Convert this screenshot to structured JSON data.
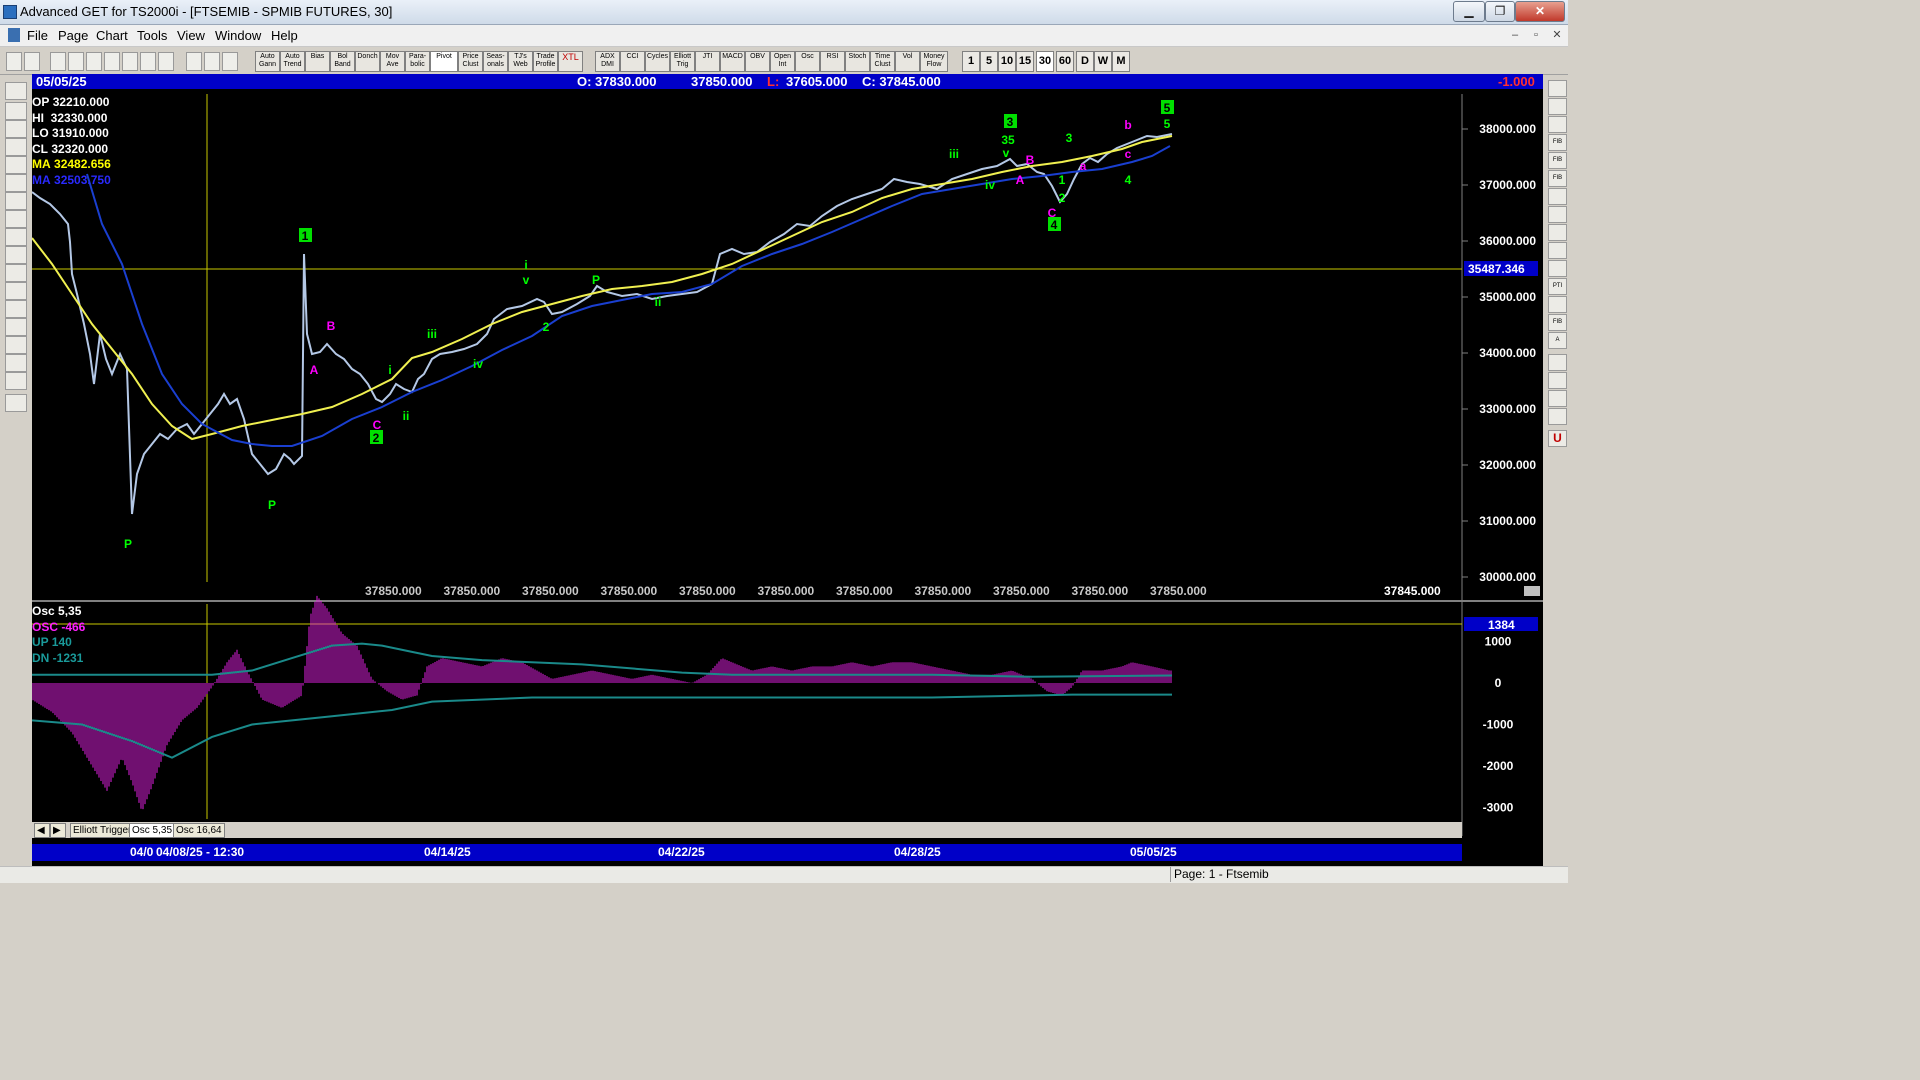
{
  "window": {
    "title": "Advanced GET for TS2000i - [FTSEMIB - SPMIB FUTURES, 30]",
    "buttons": {
      "minimize": "▁",
      "restore": "❐",
      "close": "✕"
    }
  },
  "menu": [
    "File",
    "Page",
    "Chart",
    "Tools",
    "View",
    "Window",
    "Help"
  ],
  "toolbar": {
    "studies": [
      "Auto Gann",
      "Auto Trend",
      "Bias",
      "Bol Band",
      "Donch",
      "Mov Ave",
      "Para-bolic",
      "Pivot",
      "Price Clust",
      "Seas-onals",
      "TJ's Web",
      "Trade Profile",
      "XTL",
      "ADX DMI",
      "CCI",
      "Cycles",
      "Elliott Trig",
      "JTI",
      "MACD",
      "OBV",
      "Open Int",
      "Osc",
      "RSI",
      "Stoch",
      "Time Clust",
      "Vol",
      "Money Flow"
    ],
    "timeframes": [
      "1",
      "5",
      "10",
      "15",
      "30",
      "60",
      "D",
      "W",
      "M"
    ],
    "active_timeframe": "30"
  },
  "chart_header": {
    "date": "05/05/25",
    "open": "O: 37830.000",
    "high": "37850.000",
    "low_label": "L:",
    "low": "37605.000",
    "close": "C: 37845.000",
    "change": "-1.000"
  },
  "info_box": [
    {
      "label": "OP",
      "value": "32210.000",
      "color": "#ffffff"
    },
    {
      "label": "HI",
      "value": "32330.000",
      "color": "#ffffff"
    },
    {
      "label": "LO",
      "value": "31910.000",
      "color": "#ffffff"
    },
    {
      "label": "CL",
      "value": "32320.000",
      "color": "#ffffff"
    },
    {
      "label": "MA",
      "value": "32482.656",
      "color": "#ffff00"
    },
    {
      "label": "MA",
      "value": "32503.750",
      "color": "#2a2aff"
    }
  ],
  "price_axis": {
    "ticks": [
      "38000.000",
      "37000.000",
      "36000.000",
      "35000.000",
      "34000.000",
      "33000.000",
      "32000.000",
      "31000.000",
      "30000.000"
    ],
    "crosshair_value": "35487.346"
  },
  "bottom_values": [
    "37850.000",
    "37850.000",
    "37850.000",
    "37850.000",
    "37850.000",
    "37850.000",
    "37850.000",
    "37850.000",
    "37850.000",
    "37850.000",
    "37850.000",
    "37850.000",
    "37850.000"
  ],
  "bottom_last": "37845.000",
  "oscillator": {
    "title": "Osc 5,35",
    "osc_label": "OSC -466",
    "up_label": "UP   140",
    "dn_label": "DN   -1231",
    "crosshair_value": "1384",
    "ticks": [
      "1000",
      "0",
      "-1000",
      "-2000",
      "-3000"
    ]
  },
  "tabs": [
    "Elliott Trigger",
    "Osc 5,35",
    "Osc 16,64"
  ],
  "time_axis": {
    "cursor_label": "04/08/25 - 12:30",
    "cursor_prefix": "04/0",
    "dates": [
      "04/14/25",
      "04/22/25",
      "04/28/25",
      "05/05/25"
    ]
  },
  "status": {
    "page": "Page: 1 - Ftsemib"
  },
  "wave_labels": [
    {
      "text": "1",
      "boxed": true,
      "color": "#00ff00"
    },
    {
      "text": "2",
      "boxed": true,
      "color": "#00ff00"
    },
    {
      "text": "3",
      "boxed": true,
      "color": "#00ff00"
    },
    {
      "text": "4",
      "boxed": true,
      "color": "#00ff00"
    },
    {
      "text": "5",
      "boxed": true,
      "color": "#00ff00"
    },
    {
      "text": "A",
      "color": "#ff00ff"
    },
    {
      "text": "B",
      "color": "#ff00ff"
    },
    {
      "text": "C",
      "color": "#ff00ff"
    },
    {
      "text": "P",
      "color": "#00ff00"
    },
    {
      "text": "P",
      "color": "#00ff00"
    },
    {
      "text": "P",
      "color": "#00ff00"
    },
    {
      "text": "i",
      "color": "#00ff00"
    },
    {
      "text": "ii",
      "color": "#00ff00"
    },
    {
      "text": "iii",
      "color": "#00ff00"
    },
    {
      "text": "iv",
      "color": "#00ff00"
    },
    {
      "text": "v",
      "color": "#00ff00"
    },
    {
      "text": "i",
      "color": "#00ff00"
    },
    {
      "text": "ii",
      "color": "#00ff00"
    },
    {
      "text": "iii",
      "color": "#00ff00"
    },
    {
      "text": "iv",
      "color": "#00ff00"
    },
    {
      "text": "v",
      "color": "#00ff00"
    },
    {
      "text": "2",
      "color": "#00ff00"
    },
    {
      "text": "35",
      "color": "#00ff00"
    },
    {
      "text": "A",
      "color": "#ff00ff"
    },
    {
      "text": "B",
      "color": "#ff00ff"
    },
    {
      "text": "C",
      "color": "#ff00ff"
    },
    {
      "text": "1",
      "color": "#00ff00"
    },
    {
      "text": "2",
      "color": "#00ff00"
    },
    {
      "text": "3",
      "color": "#00ff00"
    },
    {
      "text": "4",
      "color": "#00ff00"
    },
    {
      "text": "5",
      "color": "#00ff00"
    },
    {
      "text": "a",
      "color": "#ff00ff"
    },
    {
      "text": "b",
      "color": "#ff00ff"
    },
    {
      "text": "c",
      "color": "#ff00ff"
    }
  ]
}
